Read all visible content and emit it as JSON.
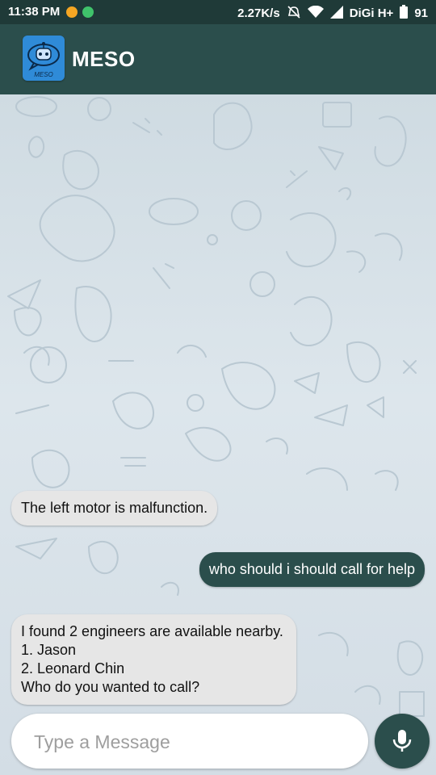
{
  "status_bar": {
    "time": "11:38 PM",
    "speed": "2.27K/s",
    "carrier": "DiGi H+",
    "battery": "91"
  },
  "app_bar": {
    "title": "MESO",
    "logo_text": "MESO"
  },
  "messages": [
    {
      "direction": "incoming",
      "lines": [
        "The left motor is malfunction."
      ]
    },
    {
      "direction": "outgoing",
      "lines": [
        "who should i should call for help"
      ]
    },
    {
      "direction": "incoming",
      "lines": [
        "I found 2 engineers are available nearby.",
        "1. Jason",
        "2. Leonard Chin",
        "Who do you wanted to call?"
      ]
    }
  ],
  "composer": {
    "placeholder": "Type a Message"
  },
  "colors": {
    "status_bar": "#1f3a38",
    "app_bar": "#2b4e4c",
    "outgoing_bubble": "#2b4e4c",
    "incoming_bubble": "#e6e6e6",
    "chat_background": "#d9e2e8"
  },
  "icons": [
    "emoji-icon",
    "chat-app-icon",
    "mute-icon",
    "wifi-icon",
    "signal-icon",
    "battery-icon",
    "robot-logo-icon",
    "microphone-icon"
  ]
}
